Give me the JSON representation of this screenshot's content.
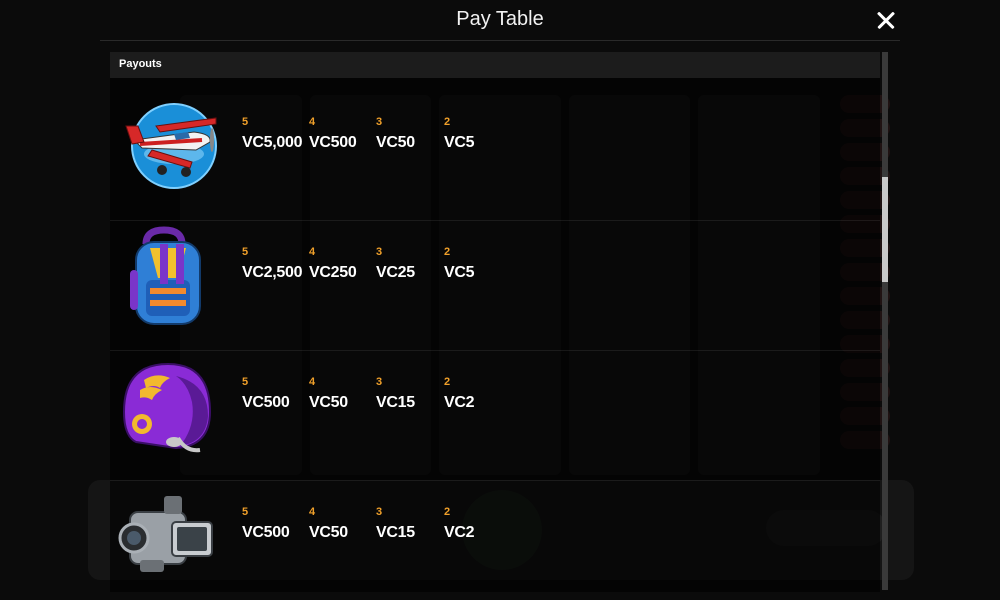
{
  "header": {
    "title": "Pay Table",
    "close_icon": "close-icon"
  },
  "section": {
    "label": "Payouts"
  },
  "colors": {
    "count_color": "#f0a02a",
    "value_color": "#ffffff"
  },
  "rows": [
    {
      "symbol": "airplane-symbol-icon",
      "payouts": [
        {
          "count": "5",
          "value": "VC5,000"
        },
        {
          "count": "4",
          "value": "VC500"
        },
        {
          "count": "3",
          "value": "VC50"
        },
        {
          "count": "2",
          "value": "VC5"
        }
      ]
    },
    {
      "symbol": "backpack-symbol-icon",
      "payouts": [
        {
          "count": "5",
          "value": "VC2,500"
        },
        {
          "count": "4",
          "value": "VC250"
        },
        {
          "count": "3",
          "value": "VC25"
        },
        {
          "count": "2",
          "value": "VC5"
        }
      ]
    },
    {
      "symbol": "helmet-symbol-icon",
      "payouts": [
        {
          "count": "5",
          "value": "VC500"
        },
        {
          "count": "4",
          "value": "VC50"
        },
        {
          "count": "3",
          "value": "VC15"
        },
        {
          "count": "2",
          "value": "VC2"
        }
      ]
    },
    {
      "symbol": "camcorder-symbol-icon",
      "payouts": [
        {
          "count": "5",
          "value": "VC500"
        },
        {
          "count": "4",
          "value": "VC50"
        },
        {
          "count": "3",
          "value": "VC15"
        },
        {
          "count": "2",
          "value": "VC2"
        }
      ]
    }
  ]
}
